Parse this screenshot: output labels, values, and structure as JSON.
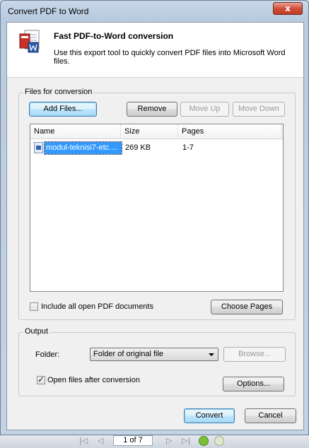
{
  "window": {
    "title": "Convert PDF to Word",
    "close_glyph": "x"
  },
  "header": {
    "icon": "pdf-to-word-icon",
    "title": "Fast PDF-to-Word conversion",
    "description": "Use this export tool to quickly convert PDF files into Microsoft Word files."
  },
  "files_group": {
    "label": "Files for conversion",
    "buttons": {
      "add": "Add Files...",
      "remove": "Remove",
      "move_up": "Move Up",
      "move_down": "Move Down"
    },
    "columns": [
      "Name",
      "Size",
      "Pages"
    ],
    "rows": [
      {
        "name": "modul-teknisi7-etc....",
        "size": "269 KB",
        "pages": "1-7",
        "selected": true
      }
    ],
    "include_all_label": "Include all open PDF documents",
    "include_all_checked": false,
    "choose_pages": "Choose Pages"
  },
  "output_group": {
    "label": "Output",
    "folder_label": "Folder:",
    "folder_value": "Folder of original file",
    "browse": "Browse...",
    "open_after_label": "Open files after conversion",
    "open_after_checked": true,
    "options": "Options..."
  },
  "footer": {
    "convert": "Convert",
    "cancel": "Cancel"
  },
  "status_bar": {
    "page_indicator": "1 of 7"
  },
  "colors": {
    "selection": "#3399ff",
    "title_bar": "#c9d8ea",
    "close_button": "#c23a22"
  }
}
